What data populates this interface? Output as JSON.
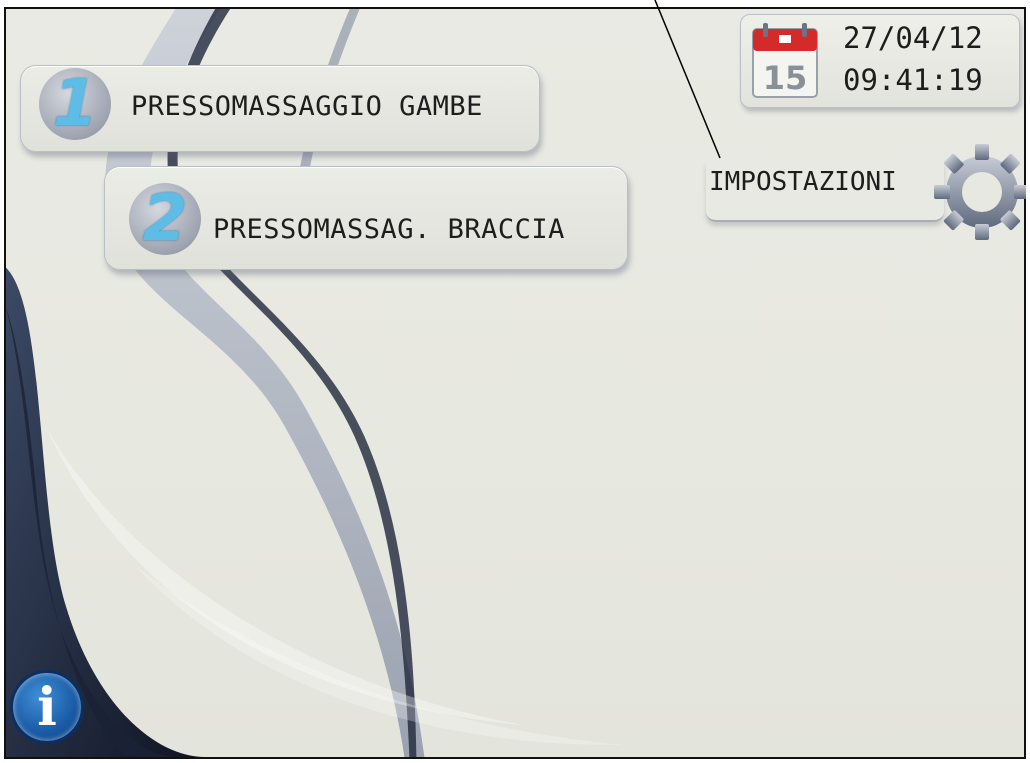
{
  "menu": {
    "item1": {
      "number": "1",
      "label": "PRESSOMASSAGGIO GAMBE"
    },
    "item2": {
      "number": "2",
      "label": "PRESSOMASSAG. BRACCIA"
    }
  },
  "settings": {
    "label": "IMPOSTAZIONI",
    "icon": "gear-icon"
  },
  "datetime": {
    "date": "27/04/12",
    "time": "09:41:19",
    "calendar_day": "15",
    "icon": "calendar-icon"
  },
  "info": {
    "glyph": "i",
    "icon": "info-icon"
  },
  "colors": {
    "accent_blue": "#5dbde6",
    "info_blue": "#1a5aa5",
    "calendar_red": "#d42a2a"
  }
}
